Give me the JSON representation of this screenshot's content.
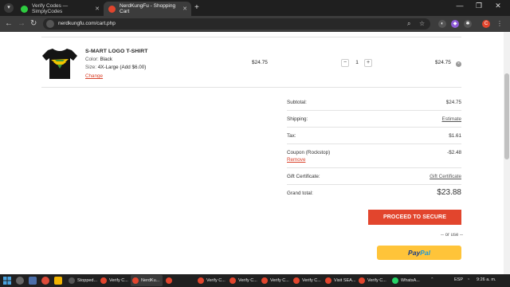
{
  "browser": {
    "tabs": [
      {
        "title": "Verify Codes — SimplyCodes",
        "active": false,
        "favicon_color": "#2ecc40"
      },
      {
        "title": "NerdKungFu - Shopping Cart",
        "active": true,
        "favicon_color": "#e2452d"
      }
    ],
    "url": "nerdkungfu.com/cart.php",
    "new_tab_label": "+",
    "profile_initial": "C"
  },
  "cart": {
    "item": {
      "name": "S-MART LOGO T-SHIRT",
      "color_label": "Color:",
      "color_value": "Black",
      "size_label": "Size:",
      "size_value": "4X-Large (Add $6.00)",
      "change_label": "Change",
      "price": "$24.75",
      "quantity": "1",
      "total": "$24.75",
      "qty_minus": "−",
      "qty_plus": "+",
      "remove_symbol": "×"
    },
    "summary": {
      "subtotal_label": "Subtotal:",
      "subtotal_value": "$24.75",
      "shipping_label": "Shipping:",
      "shipping_link": "Estimate",
      "tax_label": "Tax:",
      "tax_value": "$1.61",
      "coupon_label": "Coupon (Rockstop)",
      "coupon_value": "-$2.48",
      "coupon_remove": "Remove",
      "gift_label": "Gift Certificate:",
      "gift_link": "Gift Certificate",
      "grand_label": "Grand total:",
      "grand_value": "$23.88"
    },
    "checkout_label": "PROCEED TO SECURE CHECKOUT",
    "or_use_label": "-- or use --",
    "paypal_part1": "Pay",
    "paypal_part2": "Pal",
    "accent_color": "#e2452d",
    "paypal_color": "#ffc439"
  },
  "taskbar": {
    "apps": [
      {
        "label": "Stopped...",
        "color": "#555555",
        "active": false
      },
      {
        "label": "Verify C...",
        "color": "#e2452d",
        "active": false
      },
      {
        "label": "NerdKu...",
        "color": "#e2452d",
        "active": true
      },
      {
        "label": "",
        "color": "#e2452d",
        "active": false
      },
      {
        "label": "Verify C...",
        "color": "#e2452d",
        "active": false
      },
      {
        "label": "Verify C...",
        "color": "#e2452d",
        "active": false
      },
      {
        "label": "Verify C...",
        "color": "#e2452d",
        "active": false
      },
      {
        "label": "Verify C...",
        "color": "#e2452d",
        "active": false
      },
      {
        "label": "Visit SEA...",
        "color": "#e2452d",
        "active": false
      },
      {
        "label": "Verify C...",
        "color": "#e2452d",
        "active": false
      },
      {
        "label": "WhatsA...",
        "color": "#25d366",
        "active": false
      }
    ],
    "language": "ESP",
    "time": "9:26 a. m."
  }
}
